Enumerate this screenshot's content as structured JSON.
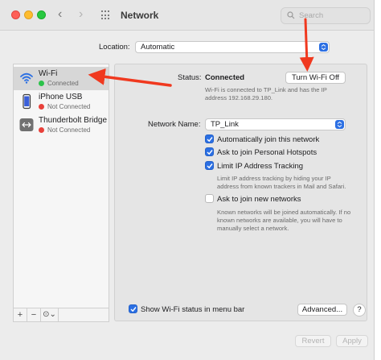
{
  "window": {
    "title": "Network"
  },
  "search": {
    "placeholder": "Search"
  },
  "location": {
    "label": "Location:",
    "value": "Automatic"
  },
  "sidebar": {
    "items": [
      {
        "name": "Wi-Fi",
        "status": "Connected",
        "status_color": "#2cc24a"
      },
      {
        "name": "iPhone USB",
        "status": "Not Connected",
        "status_color": "#e8403a"
      },
      {
        "name": "Thunderbolt Bridge",
        "status": "Not Connected",
        "status_color": "#e8403a"
      }
    ],
    "footer": {
      "add": "+",
      "remove": "−",
      "action": "⊙⌄"
    }
  },
  "status": {
    "label": "Status:",
    "value": "Connected",
    "button": "Turn Wi-Fi Off",
    "description_line1": "Wi-Fi is connected to TP_Link and has the IP",
    "description_line2": "address 192.168.29.180."
  },
  "network_name": {
    "label": "Network Name:",
    "value": "TP_Link"
  },
  "options": {
    "auto_join": {
      "label": "Automatically join this network",
      "checked": true
    },
    "hotspots": {
      "label": "Ask to join Personal Hotspots",
      "checked": true
    },
    "limit_ip": {
      "label": "Limit IP Address Tracking",
      "checked": true
    },
    "limit_ip_desc1": "Limit IP address tracking by hiding your IP",
    "limit_ip_desc2": "address from known trackers in Mail and Safari.",
    "ask_join": {
      "label": "Ask to join new networks",
      "checked": false
    },
    "ask_join_desc1": "Known networks will be joined automatically. If no",
    "ask_join_desc2": "known networks are available, you will have to",
    "ask_join_desc3": "manually select a network."
  },
  "menu_bar": {
    "label": "Show Wi-Fi status in menu bar",
    "checked": true
  },
  "advanced_button": "Advanced...",
  "help_button": "?",
  "revert_button": "Revert",
  "apply_button": "Apply",
  "colors": {
    "accent": "#2b6fe3",
    "annotation": "#f0391f"
  }
}
